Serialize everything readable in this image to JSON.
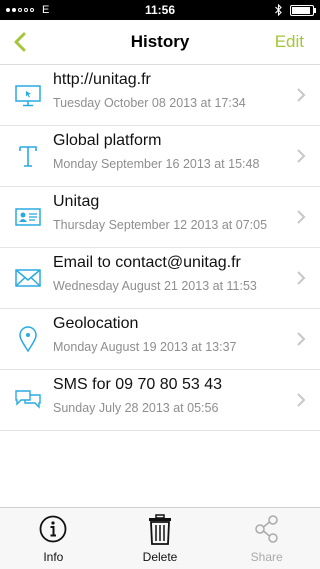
{
  "status_bar": {
    "carrier": "E",
    "time": "11:56",
    "battery_level": 0.9
  },
  "nav": {
    "title": "History",
    "edit_label": "Edit",
    "accent_color": "#a4c639"
  },
  "history": [
    {
      "icon": "monitor-icon",
      "title": "http://unitag.fr",
      "date": "Tuesday October 08 2013 at 17:34"
    },
    {
      "icon": "text-icon",
      "title": "Global platform",
      "date": "Monday September 16 2013 at 15:48"
    },
    {
      "icon": "contact-card-icon",
      "title": "Unitag",
      "date": "Thursday September 12 2013 at 07:05"
    },
    {
      "icon": "envelope-icon",
      "title": "Email to contact@unitag.fr",
      "date": "Wednesday August  21 2013 at 11:53"
    },
    {
      "icon": "location-pin-icon",
      "title": "Geolocation",
      "date": "Monday August 19 2013 at 13:37"
    },
    {
      "icon": "chat-bubbles-icon",
      "title": "SMS for 09 70 80 53 43",
      "date": "Sunday July 28 2013 at 05:56"
    }
  ],
  "tab_bar": {
    "info": "Info",
    "delete": "Delete",
    "share": "Share"
  },
  "icon_color": "#29abe2"
}
